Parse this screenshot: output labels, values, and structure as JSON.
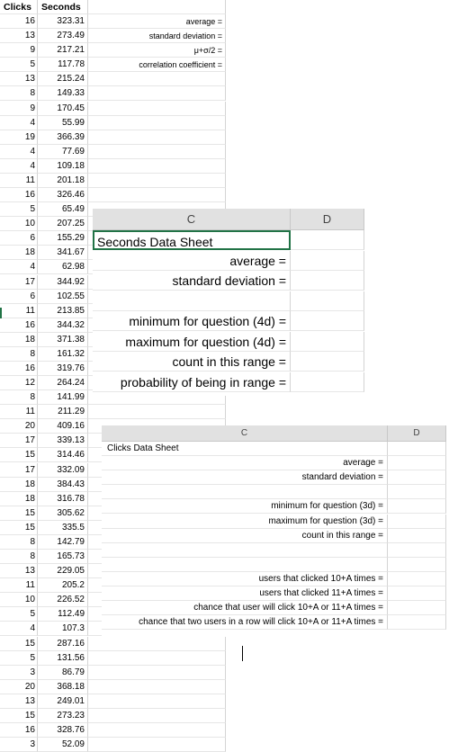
{
  "main": {
    "header": {
      "clicks": "Clicks",
      "seconds": "Seconds"
    },
    "rows": [
      {
        "clicks": "16",
        "seconds": "323.31",
        "label": "average ="
      },
      {
        "clicks": "13",
        "seconds": "273.49",
        "label": "standard deviation ="
      },
      {
        "clicks": "9",
        "seconds": "217.21",
        "label": "μ+σ/2 ="
      },
      {
        "clicks": "5",
        "seconds": "117.78",
        "label": "correlation coefficient ="
      },
      {
        "clicks": "13",
        "seconds": "215.24",
        "label": ""
      },
      {
        "clicks": "8",
        "seconds": "149.33",
        "label": ""
      },
      {
        "clicks": "9",
        "seconds": "170.45",
        "label": ""
      },
      {
        "clicks": "4",
        "seconds": "55.99",
        "label": ""
      },
      {
        "clicks": "19",
        "seconds": "366.39",
        "label": ""
      },
      {
        "clicks": "4",
        "seconds": "77.69",
        "label": ""
      },
      {
        "clicks": "4",
        "seconds": "109.18",
        "label": ""
      },
      {
        "clicks": "11",
        "seconds": "201.18",
        "label": ""
      },
      {
        "clicks": "16",
        "seconds": "326.46",
        "label": ""
      },
      {
        "clicks": "5",
        "seconds": "65.49",
        "label": ""
      },
      {
        "clicks": "10",
        "seconds": "207.25",
        "label": ""
      },
      {
        "clicks": "6",
        "seconds": "155.29",
        "label": ""
      },
      {
        "clicks": "18",
        "seconds": "341.67",
        "label": ""
      },
      {
        "clicks": "4",
        "seconds": "62.98",
        "label": ""
      },
      {
        "clicks": "17",
        "seconds": "344.92",
        "label": ""
      },
      {
        "clicks": "6",
        "seconds": "102.55",
        "label": ""
      },
      {
        "clicks": "11",
        "seconds": "213.85",
        "label": ""
      },
      {
        "clicks": "16",
        "seconds": "344.32",
        "label": ""
      },
      {
        "clicks": "18",
        "seconds": "371.38",
        "label": ""
      },
      {
        "clicks": "8",
        "seconds": "161.32",
        "label": ""
      },
      {
        "clicks": "16",
        "seconds": "319.76",
        "label": ""
      },
      {
        "clicks": "12",
        "seconds": "264.24",
        "label": ""
      },
      {
        "clicks": "8",
        "seconds": "141.99",
        "label": ""
      },
      {
        "clicks": "11",
        "seconds": "211.29",
        "label": ""
      },
      {
        "clicks": "20",
        "seconds": "409.16",
        "label": ""
      },
      {
        "clicks": "17",
        "seconds": "339.13",
        "label": ""
      },
      {
        "clicks": "15",
        "seconds": "314.46",
        "label": ""
      },
      {
        "clicks": "17",
        "seconds": "332.09",
        "label": ""
      },
      {
        "clicks": "18",
        "seconds": "384.43",
        "label": ""
      },
      {
        "clicks": "18",
        "seconds": "316.78",
        "label": ""
      },
      {
        "clicks": "15",
        "seconds": "305.62",
        "label": ""
      },
      {
        "clicks": "15",
        "seconds": "335.5",
        "label": ""
      },
      {
        "clicks": "8",
        "seconds": "142.79",
        "label": ""
      },
      {
        "clicks": "8",
        "seconds": "165.73",
        "label": ""
      },
      {
        "clicks": "13",
        "seconds": "229.05",
        "label": ""
      },
      {
        "clicks": "11",
        "seconds": "205.2",
        "label": ""
      },
      {
        "clicks": "10",
        "seconds": "226.52",
        "label": ""
      },
      {
        "clicks": "5",
        "seconds": "112.49",
        "label": ""
      },
      {
        "clicks": "4",
        "seconds": "107.3",
        "label": ""
      },
      {
        "clicks": "15",
        "seconds": "287.16",
        "label": ""
      },
      {
        "clicks": "5",
        "seconds": "131.56",
        "label": ""
      },
      {
        "clicks": "3",
        "seconds": "86.79",
        "label": ""
      },
      {
        "clicks": "20",
        "seconds": "368.18",
        "label": ""
      },
      {
        "clicks": "13",
        "seconds": "249.01",
        "label": ""
      },
      {
        "clicks": "15",
        "seconds": "273.23",
        "label": ""
      },
      {
        "clicks": "16",
        "seconds": "328.76",
        "label": ""
      },
      {
        "clicks": "3",
        "seconds": "52.09",
        "label": ""
      }
    ]
  },
  "seconds_sheet": {
    "col_c": "C",
    "col_d": "D",
    "rows": [
      "Seconds Data Sheet",
      "average =",
      "standard deviation =",
      "",
      "minimum for question (4d) =",
      "maximum for question (4d) =",
      "count in this range =",
      "probability of being in range ="
    ]
  },
  "clicks_sheet": {
    "col_c": "C",
    "col_d": "D",
    "rows": [
      "Clicks Data Sheet",
      "average =",
      "standard deviation =",
      "",
      "minimum for question (3d) =",
      "maximum for question (3d) =",
      "count in this range =",
      "",
      "",
      "users that clicked 10+A  times =",
      "users that clicked 11+A  times =",
      "chance that user will click 10+A  or 11+A times =",
      "chance that two users in a row will click 10+A  or 11+A times ="
    ]
  }
}
